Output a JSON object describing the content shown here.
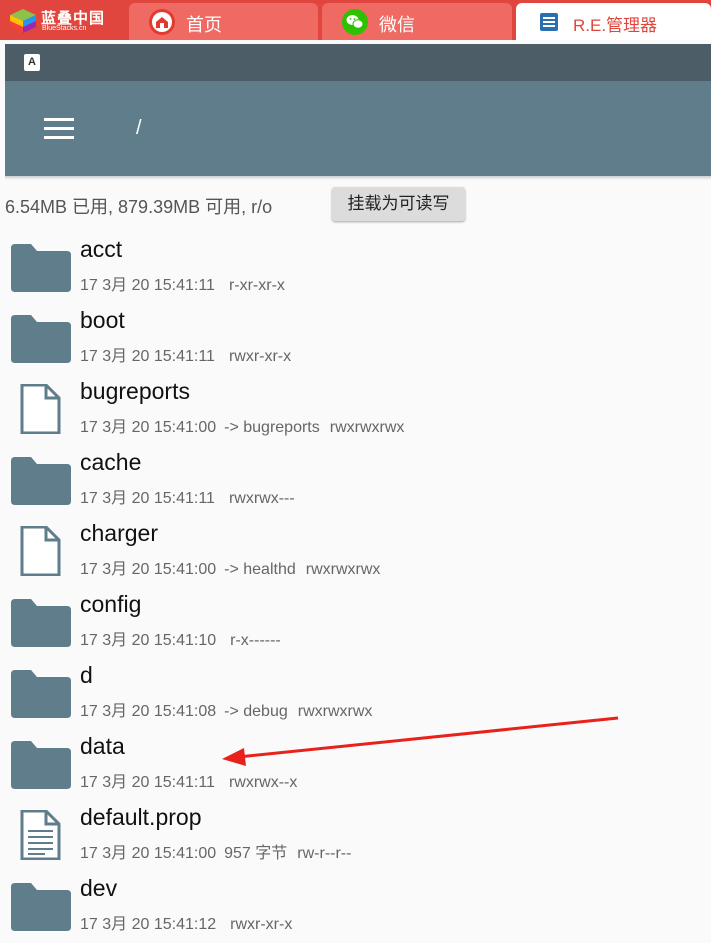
{
  "host": {
    "logo_cn": "蓝叠中国",
    "logo_en": "BlueStacks.cn",
    "tabs": [
      {
        "label": "首页",
        "icon": "home-icon"
      },
      {
        "label": "微信",
        "icon": "wechat-icon"
      },
      {
        "label": "R.E.管理器",
        "icon": "re-manager-icon",
        "active": true
      }
    ],
    "accent": "#e0463d"
  },
  "status": {
    "indicator": "A"
  },
  "toolbar": {
    "path": "/",
    "color": "#5f7d8b"
  },
  "storage": {
    "info": "6.54MB 已用, 879.39MB 可用, r/o",
    "mount_button": "挂载为可读写"
  },
  "files": [
    {
      "name": "acct",
      "type": "folder",
      "date": "17 3月 20 15:41:11",
      "link": "",
      "perm": "r-xr-xr-x"
    },
    {
      "name": "boot",
      "type": "folder",
      "date": "17 3月 20 15:41:11",
      "link": "",
      "perm": "rwxr-xr-x"
    },
    {
      "name": "bugreports",
      "type": "file",
      "date": "17 3月 20 15:41:00",
      "link": "-> bugreports",
      "perm": "rwxrwxrwx"
    },
    {
      "name": "cache",
      "type": "folder",
      "date": "17 3月 20 15:41:11",
      "link": "",
      "perm": "rwxrwx---"
    },
    {
      "name": "charger",
      "type": "file",
      "date": "17 3月 20 15:41:00",
      "link": "-> healthd",
      "perm": "rwxrwxrwx"
    },
    {
      "name": "config",
      "type": "folder",
      "date": "17 3月 20 15:41:10",
      "link": "",
      "perm": "r-x------"
    },
    {
      "name": "d",
      "type": "folder",
      "date": "17 3月 20 15:41:08",
      "link": "-> debug",
      "perm": "rwxrwxrwx"
    },
    {
      "name": "data",
      "type": "folder",
      "date": "17 3月 20 15:41:11",
      "link": "",
      "perm": "rwxrwx--x"
    },
    {
      "name": "default.prop",
      "type": "text-file",
      "date": "17 3月 20 15:41:00",
      "link": "957 字节",
      "perm": "rw-r--r--"
    },
    {
      "name": "dev",
      "type": "folder",
      "date": "17 3月 20 15:41:12",
      "link": "",
      "perm": "rwxr-xr-x"
    }
  ],
  "annotation": {
    "arrow_color": "#e8221b",
    "points_to": "data"
  }
}
